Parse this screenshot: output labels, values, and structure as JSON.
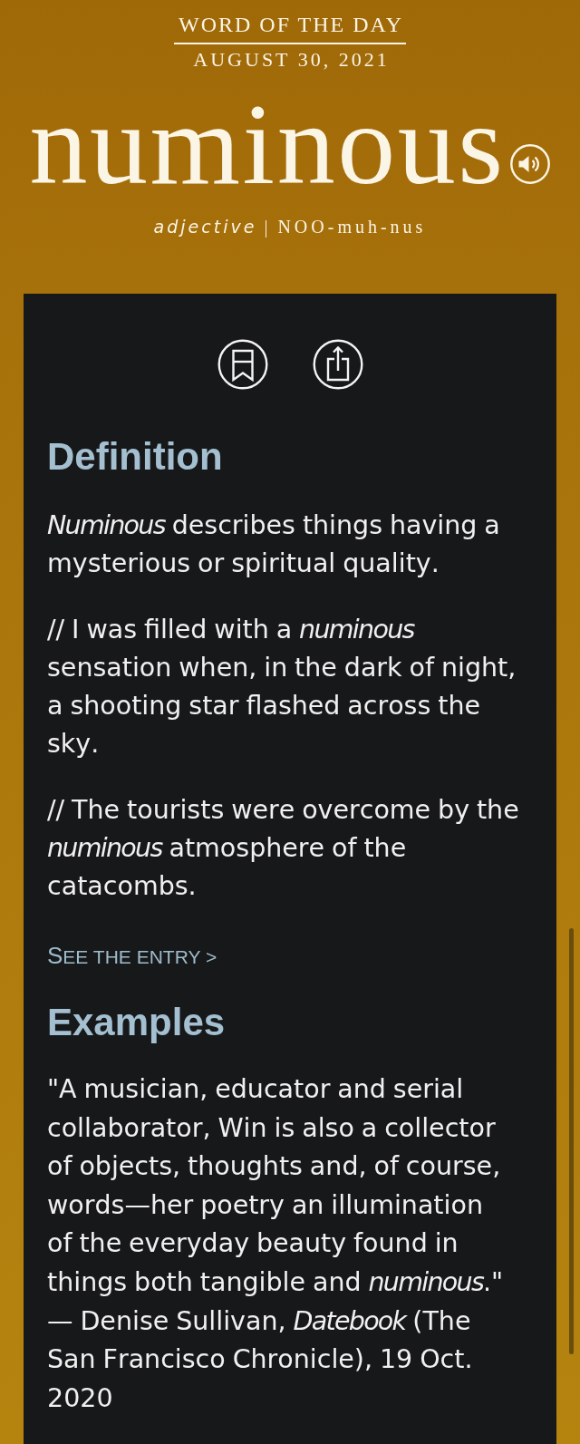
{
  "header": {
    "eyebrow": "WORD OF THE DAY",
    "date": "AUGUST 30, 2021",
    "word": "numinous",
    "part_of_speech": "adjective",
    "separator": "|",
    "pronunciation": "NOO-muh-nus"
  },
  "actions": [
    {
      "kind": "bookmark"
    },
    {
      "kind": "share"
    }
  ],
  "definition": {
    "heading": "Definition",
    "text": "*Numinous* describes things having a mysterious or spiritual quality.",
    "examples": [
      "// I was filled with a *numinous* sensation when, in the dark of night, a shooting star flashed across the sky.",
      "// The tourists were overcome by the *numinous* atmosphere of the catacombs."
    ],
    "link": "SEE THE ENTRY >"
  },
  "examples": {
    "heading": "Examples",
    "quote": "\"A musician, educator and serial collaborator, Win is also a collector of objects, thoughts and, of course, words—her poetry an illumination of the everyday beauty found in things both tangible and *numinous*.\"",
    "attribution": "— Denise Sullivan, *Datebook* (The San Francisco Chronicle), 19 Oct. 2020"
  }
}
